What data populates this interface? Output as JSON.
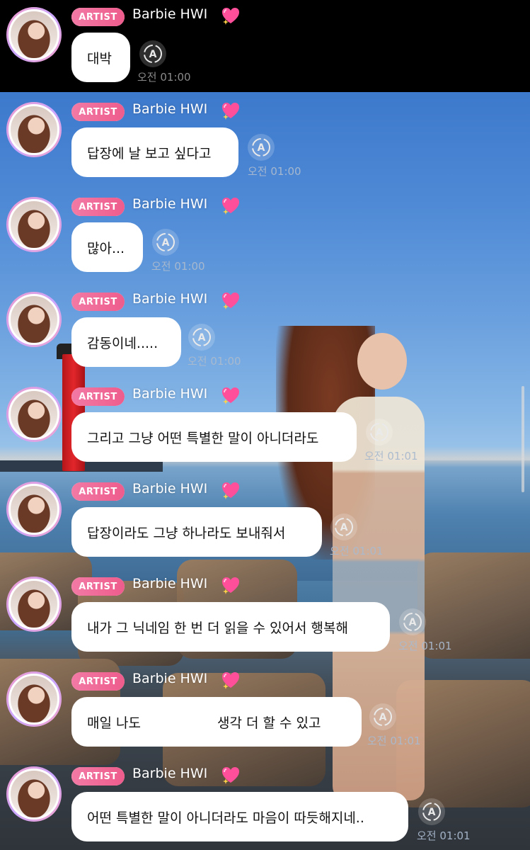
{
  "artist_badge": "ARTIST",
  "sender_name": "Barbie HWI",
  "messages": [
    {
      "text": "대박",
      "time": "오전 01:00"
    },
    {
      "text": "답장에 날 보고 싶다고",
      "time": "오전 01:00"
    },
    {
      "text": "많아...",
      "time": "오전 01:00"
    },
    {
      "text": "감동이네.....",
      "time": "오전 01:00"
    },
    {
      "text": "그리고 그냥 어떤 특별한 말이 아니더라도",
      "time": "오전 01:01"
    },
    {
      "text": "답장이라도 그냥 하나라도 보내줘서",
      "time": "오전 01:01"
    },
    {
      "text": "내가 그 닉네임 한 번 더 읽을 수 있어서 행복해",
      "time": "오전 01:01"
    },
    {
      "text_before": "매일 나도",
      "text_after": "생각 더 할 수 있고",
      "time": "오전 01:01"
    },
    {
      "text": "어떤 특별한 말이 아니더라도 마음이 따듯해지네..",
      "time": "오전 01:01"
    }
  ],
  "colors": {
    "badge_pink": "#ee5c8c",
    "heart_pink": "#ff4f9a",
    "bubble": "#ffffff"
  },
  "icons": {
    "translate": "translate-icon",
    "heart": "sparkling-heart-icon"
  }
}
